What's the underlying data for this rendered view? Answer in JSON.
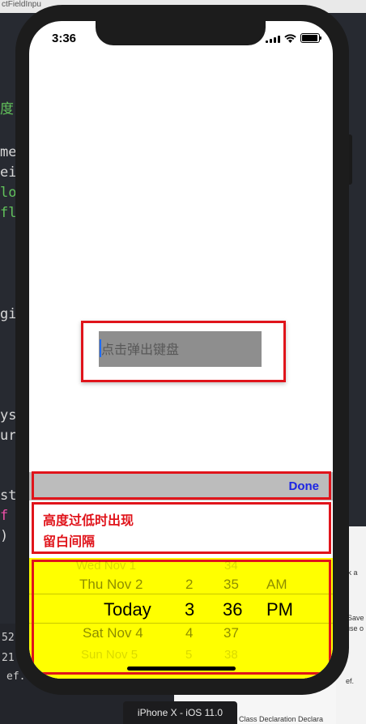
{
  "editor": {
    "tab_title": "ctFieldInpu",
    "code_lines": [
      "度",
      "me",
      "ei",
      "lo",
      "fl",
      "gi",
      "ys",
      "ur",
      "st",
      "f",
      ")"
    ],
    "gutter_numbers": [
      "52",
      "21",
      "ef."
    ],
    "right_panel": [
      "ck a",
      "Save",
      "use o",
      "ef."
    ],
    "right_panel_bottom": "Class Declaration   Declara"
  },
  "simulator_label": "iPhone X - iOS 11.0",
  "status_bar": {
    "time": "3:36"
  },
  "textfield": {
    "placeholder": "点击弹出键盘"
  },
  "toolbar": {
    "done_label": "Done"
  },
  "gap_note": {
    "line1": "高度过低时出现",
    "line2": "留白间隔"
  },
  "picker": {
    "dates": [
      "Wed Nov 1",
      "Thu Nov 2",
      "Today",
      "Sat Nov 4",
      "Sun Nov 5"
    ],
    "hours": [
      "2",
      "2",
      "3",
      "4",
      "5"
    ],
    "minutes": [
      "34",
      "35",
      "36",
      "37",
      "38"
    ],
    "ampm": [
      "AM",
      "PM"
    ]
  },
  "colors": {
    "annotation_red": "#e0141b",
    "picker_bg": "#ffff00",
    "done_blue": "#1d25e4"
  }
}
